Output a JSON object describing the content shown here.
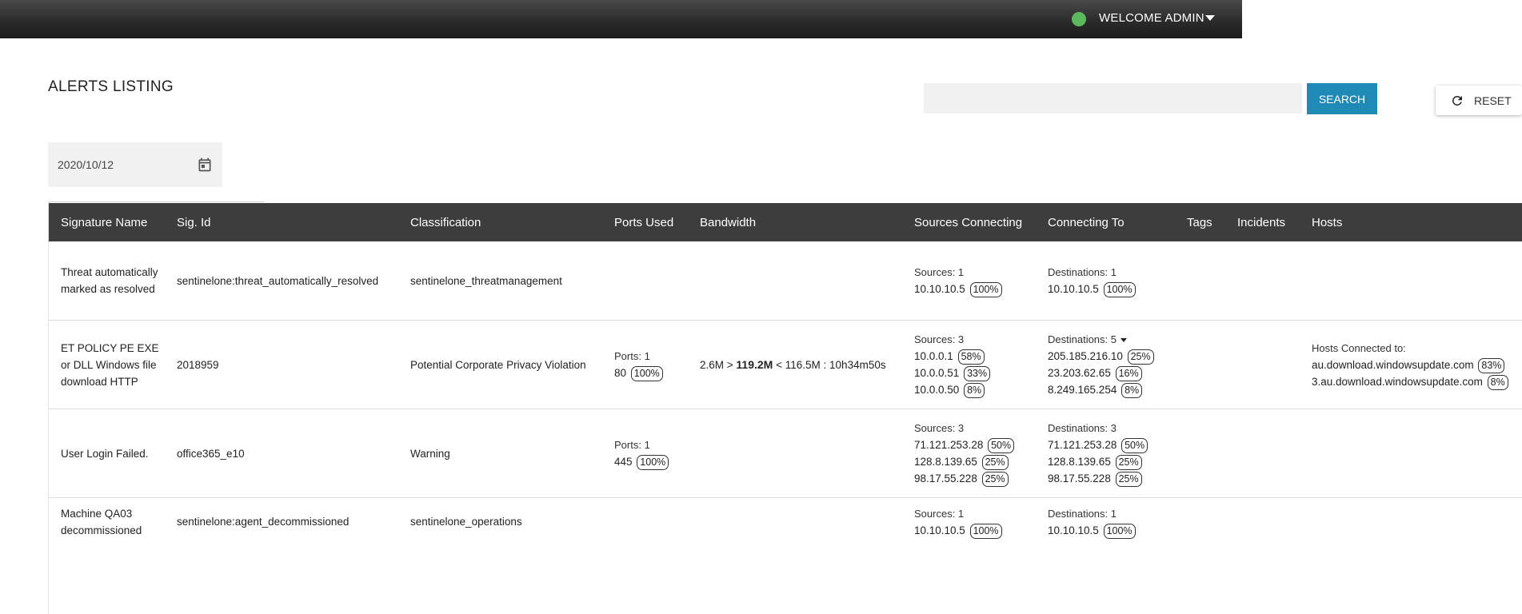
{
  "header": {
    "welcome": "WELCOME ADMIN",
    "status_color": "#5cb85c"
  },
  "page": {
    "title": "ALERTS LISTING",
    "search_placeholder": "",
    "search_label": "SEARCH",
    "reset_label": "RESET",
    "date_value": "2020/10/12"
  },
  "table": {
    "columns": {
      "signature_name": "Signature Name",
      "sig_id": "Sig. Id",
      "classification": "Classification",
      "ports_used": "Ports Used",
      "bandwidth": "Bandwidth",
      "sources": "Sources Connecting",
      "connecting_to": "Connecting To",
      "tags": "Tags",
      "incidents": "Incidents",
      "hosts": "Hosts"
    },
    "rows": [
      {
        "name": "Threat automatically marked as resolved",
        "sig_id": "sentinelone:threat_automatically_resolved",
        "classification": "sentinelone_threatmanagement",
        "sources_label": "Sources: 1",
        "sources": [
          {
            "ip": "10.10.10.5",
            "pct": "100%"
          }
        ],
        "dest_label": "Destinations: 1",
        "dest": [
          {
            "ip": "10.10.10.5",
            "pct": "100%"
          }
        ]
      },
      {
        "name": "ET POLICY PE EXE or DLL Windows file download HTTP",
        "sig_id": "2018959",
        "classification": "Potential Corporate Privacy Violation",
        "ports_label": "Ports: 1",
        "port": "80",
        "port_pct": "100%",
        "bw_in": "2.6M >",
        "bw_main": "119.2M",
        "bw_out": "< 116.5M : 10h34m50s",
        "sources_label": "Sources: 3",
        "sources": [
          {
            "ip": "10.0.0.1",
            "pct": "58%"
          },
          {
            "ip": "10.0.0.51",
            "pct": "33%"
          },
          {
            "ip": "10.0.0.50",
            "pct": "8%"
          }
        ],
        "dest_label": "Destinations: 5",
        "dest": [
          {
            "ip": "205.185.216.10",
            "pct": "25%"
          },
          {
            "ip": "23.203.62.65",
            "pct": "16%"
          },
          {
            "ip": "8.249.165.254",
            "pct": "8%"
          }
        ],
        "hosts_label": "Hosts Connected to:",
        "hosts": [
          {
            "name": "au.download.windowsupdate.com",
            "pct": "83%"
          },
          {
            "name": "3.au.download.windowsupdate.com",
            "pct": "8%"
          }
        ]
      },
      {
        "name": "User Login Failed.",
        "sig_id": "office365_e10",
        "classification": "Warning",
        "ports_label": "Ports: 1",
        "port": "445",
        "port_pct": "100%",
        "sources_label": "Sources: 3",
        "sources": [
          {
            "ip": "71.121.253.28",
            "pct": "50%"
          },
          {
            "ip": "128.8.139.65",
            "pct": "25%"
          },
          {
            "ip": "98.17.55.228",
            "pct": "25%"
          }
        ],
        "dest_label": "Destinations: 3",
        "dest": [
          {
            "ip": "71.121.253.28",
            "pct": "50%"
          },
          {
            "ip": "128.8.139.65",
            "pct": "25%"
          },
          {
            "ip": "98.17.55.228",
            "pct": "25%"
          }
        ]
      },
      {
        "name": "Machine QA03 decommissioned",
        "sig_id": "sentinelone:agent_decommissioned",
        "classification": "sentinelone_operations",
        "sources_label": "Sources: 1",
        "sources": [
          {
            "ip": "10.10.10.5",
            "pct": "100%"
          }
        ],
        "dest_label": "Destinations: 1",
        "dest": [
          {
            "ip": "10.10.10.5",
            "pct": "100%"
          }
        ]
      }
    ]
  }
}
